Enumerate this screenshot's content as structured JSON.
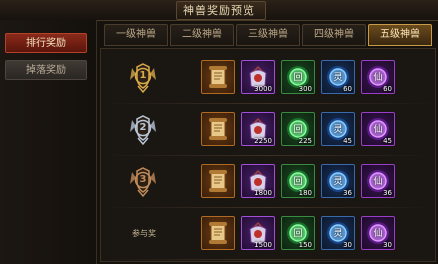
{
  "window": {
    "title": "神兽奖励预览"
  },
  "sidebar": {
    "items": [
      {
        "label": "排行奖励",
        "active": true
      },
      {
        "label": "掉落奖励",
        "active": false
      }
    ]
  },
  "tabs": [
    {
      "label": "一级神兽",
      "active": false
    },
    {
      "label": "二级神兽",
      "active": false
    },
    {
      "label": "三级神兽",
      "active": false
    },
    {
      "label": "四级神兽",
      "active": false
    },
    {
      "label": "五级神兽",
      "active": true
    }
  ],
  "rows": [
    {
      "rank": "1",
      "rank_label": "",
      "items": [
        {
          "icon": "scroll-icon",
          "quality": "orange",
          "qty": ""
        },
        {
          "icon": "gift-pouch-icon",
          "quality": "purple",
          "qty": "3000"
        },
        {
          "icon": "green-orb-icon",
          "quality": "green",
          "qty": "300",
          "glyph": "回"
        },
        {
          "icon": "blue-orb-icon",
          "quality": "blue",
          "qty": "60",
          "glyph": "灵"
        },
        {
          "icon": "violet-orb-icon",
          "quality": "violet",
          "qty": "60",
          "glyph": "仙"
        }
      ]
    },
    {
      "rank": "2",
      "rank_label": "",
      "items": [
        {
          "icon": "scroll-icon",
          "quality": "orange",
          "qty": ""
        },
        {
          "icon": "gift-pouch-icon",
          "quality": "purple",
          "qty": "2250"
        },
        {
          "icon": "green-orb-icon",
          "quality": "green",
          "qty": "225",
          "glyph": "回"
        },
        {
          "icon": "blue-orb-icon",
          "quality": "blue",
          "qty": "45",
          "glyph": "灵"
        },
        {
          "icon": "violet-orb-icon",
          "quality": "violet",
          "qty": "45",
          "glyph": "仙"
        }
      ]
    },
    {
      "rank": "3",
      "rank_label": "",
      "items": [
        {
          "icon": "scroll-icon",
          "quality": "orange",
          "qty": ""
        },
        {
          "icon": "gift-pouch-icon",
          "quality": "purple",
          "qty": "1800"
        },
        {
          "icon": "green-orb-icon",
          "quality": "green",
          "qty": "180",
          "glyph": "回"
        },
        {
          "icon": "blue-orb-icon",
          "quality": "blue",
          "qty": "36",
          "glyph": "灵"
        },
        {
          "icon": "violet-orb-icon",
          "quality": "violet",
          "qty": "36",
          "glyph": "仙"
        }
      ]
    },
    {
      "rank": "",
      "rank_label": "参与奖",
      "items": [
        {
          "icon": "scroll-icon",
          "quality": "orange",
          "qty": ""
        },
        {
          "icon": "gift-pouch-icon",
          "quality": "purple",
          "qty": "1500"
        },
        {
          "icon": "green-orb-icon",
          "quality": "green",
          "qty": "150",
          "glyph": "回"
        },
        {
          "icon": "blue-orb-icon",
          "quality": "blue",
          "qty": "30",
          "glyph": "灵"
        },
        {
          "icon": "violet-orb-icon",
          "quality": "violet",
          "qty": "30",
          "glyph": "仙"
        }
      ]
    }
  ],
  "colors": {
    "gold": "#d8a84a",
    "silver": "#b8c6d6",
    "bronze": "#c08a5a",
    "active_tab": "#c99a4a",
    "active_side": "#8a2a1a"
  }
}
